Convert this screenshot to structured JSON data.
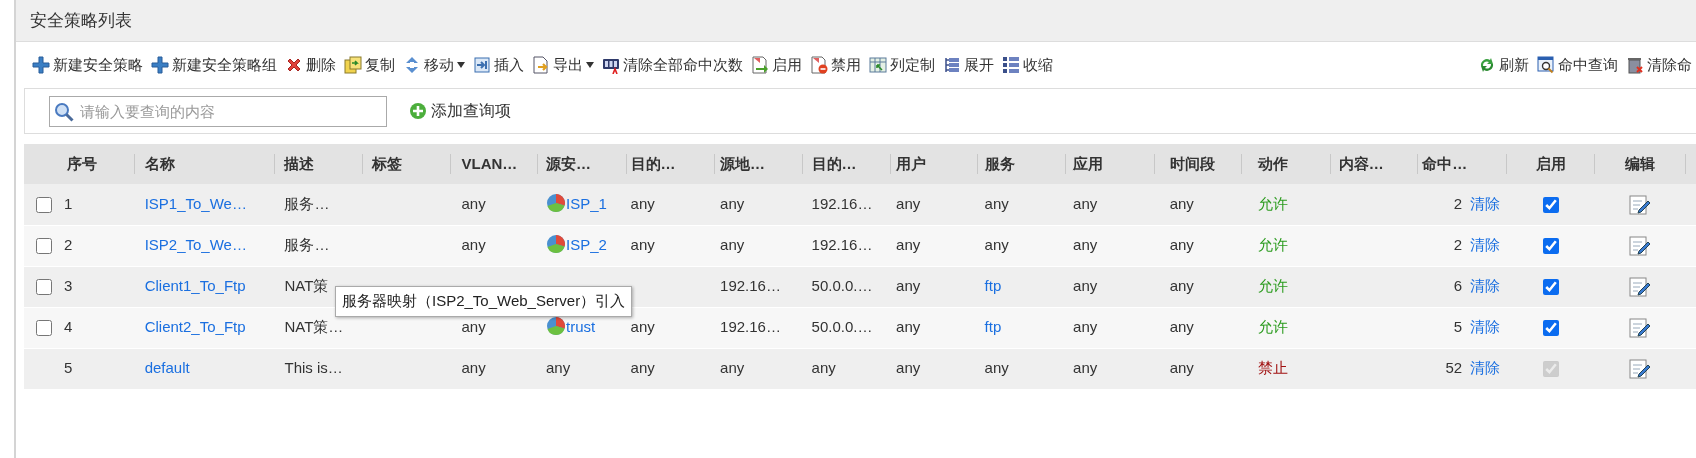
{
  "panel": {
    "title": "安全策略列表"
  },
  "toolbar": {
    "left": [
      {
        "kind": "plus",
        "label": "新建安全策略",
        "caret": false
      },
      {
        "kind": "plus",
        "label": "新建安全策略组",
        "caret": false
      },
      {
        "kind": "delete",
        "label": "删除",
        "caret": false
      },
      {
        "kind": "copy",
        "label": "复制",
        "caret": false
      },
      {
        "kind": "move",
        "label": "移动",
        "caret": true
      },
      {
        "kind": "insert",
        "label": "插入",
        "caret": false
      },
      {
        "kind": "export",
        "label": "导出",
        "caret": true
      },
      {
        "kind": "counter",
        "label": "清除全部命中次数",
        "caret": false
      },
      {
        "kind": "enable",
        "label": "启用",
        "caret": false
      },
      {
        "kind": "disable",
        "label": "禁用",
        "caret": false
      },
      {
        "kind": "columns",
        "label": "列定制",
        "caret": false
      },
      {
        "kind": "expand",
        "label": "展开",
        "caret": false
      },
      {
        "kind": "collapse",
        "label": "收缩",
        "caret": false
      }
    ],
    "right": [
      {
        "kind": "refresh",
        "label": "刷新",
        "caret": false
      },
      {
        "kind": "query",
        "label": "命中查询",
        "caret": false
      },
      {
        "kind": "trash",
        "label": "清除命",
        "caret": false
      }
    ]
  },
  "search": {
    "placeholder": "请输入要查询的内容",
    "add_button": "添加查询项"
  },
  "table": {
    "columns": [
      "序号",
      "名称",
      "描述",
      "标签",
      "VLAN…",
      "源安…",
      "目的…",
      "源地…",
      "目的…",
      "用户",
      "服务",
      "应用",
      "时间段",
      "动作",
      "内容…",
      "命中…",
      "启用",
      "编辑"
    ],
    "rows": [
      {
        "selectable": true,
        "selected": false,
        "cells": [
          {
            "kind": "seq",
            "text": "1"
          },
          {
            "kind": "link",
            "text": "ISP1_To_We…"
          },
          {
            "kind": "plain",
            "text": "服务…"
          },
          "",
          {
            "kind": "plain",
            "text": "any"
          },
          {
            "kind": "zone",
            "text": "ISP_1"
          },
          {
            "kind": "plain",
            "text": "any"
          },
          {
            "kind": "plain",
            "text": "any"
          },
          {
            "kind": "plain",
            "text": "192.16…"
          },
          {
            "kind": "plain",
            "text": "any"
          },
          {
            "kind": "plain",
            "text": "any"
          },
          {
            "kind": "plain",
            "text": "any"
          },
          {
            "kind": "plain",
            "text": "any"
          },
          {
            "kind": "allow",
            "text": "允许"
          },
          "",
          {
            "kind": "hits",
            "text": "2",
            "link": "清除"
          },
          {
            "kind": "check",
            "checked": true,
            "disabled": false
          },
          {
            "kind": "edit"
          }
        ]
      },
      {
        "selectable": true,
        "selected": false,
        "cells": [
          {
            "kind": "seq",
            "text": "2"
          },
          {
            "kind": "link",
            "text": "ISP2_To_We…"
          },
          {
            "kind": "plain",
            "text": "服务…"
          },
          "",
          {
            "kind": "plain",
            "text": "any"
          },
          {
            "kind": "zone",
            "text": "ISP_2"
          },
          {
            "kind": "plain",
            "text": "any"
          },
          {
            "kind": "plain",
            "text": "any"
          },
          {
            "kind": "plain",
            "text": "192.16…"
          },
          {
            "kind": "plain",
            "text": "any"
          },
          {
            "kind": "plain",
            "text": "any"
          },
          {
            "kind": "plain",
            "text": "any"
          },
          {
            "kind": "plain",
            "text": "any"
          },
          {
            "kind": "allow",
            "text": "允许"
          },
          "",
          {
            "kind": "hits",
            "text": "2",
            "link": "清除"
          },
          {
            "kind": "check",
            "checked": true,
            "disabled": false
          },
          {
            "kind": "edit"
          }
        ]
      },
      {
        "selectable": true,
        "selected": false,
        "cells": [
          {
            "kind": "seq",
            "text": "3"
          },
          {
            "kind": "link",
            "text": "Client1_To_Ftp"
          },
          {
            "kind": "plain",
            "text": "NAT策"
          },
          "",
          "",
          "",
          "",
          {
            "kind": "plain",
            "text": "192.16…"
          },
          {
            "kind": "plain",
            "text": "50.0.0.…"
          },
          {
            "kind": "plain",
            "text": "any"
          },
          {
            "kind": "link",
            "text": "ftp"
          },
          {
            "kind": "plain",
            "text": "any"
          },
          {
            "kind": "plain",
            "text": "any"
          },
          {
            "kind": "allow",
            "text": "允许"
          },
          "",
          {
            "kind": "hits",
            "text": "6",
            "link": "清除"
          },
          {
            "kind": "check",
            "checked": true,
            "disabled": false
          },
          {
            "kind": "edit"
          }
        ]
      },
      {
        "selectable": true,
        "selected": false,
        "cells": [
          {
            "kind": "seq",
            "text": "4"
          },
          {
            "kind": "link",
            "text": "Client2_To_Ftp"
          },
          {
            "kind": "plain",
            "text": "NAT策…"
          },
          "",
          {
            "kind": "plain",
            "text": "any"
          },
          {
            "kind": "zone",
            "text": "trust"
          },
          {
            "kind": "plain",
            "text": "any"
          },
          {
            "kind": "plain",
            "text": "192.16…"
          },
          {
            "kind": "plain",
            "text": "50.0.0.…"
          },
          {
            "kind": "plain",
            "text": "any"
          },
          {
            "kind": "link",
            "text": "ftp"
          },
          {
            "kind": "plain",
            "text": "any"
          },
          {
            "kind": "plain",
            "text": "any"
          },
          {
            "kind": "allow",
            "text": "允许"
          },
          "",
          {
            "kind": "hits",
            "text": "5",
            "link": "清除"
          },
          {
            "kind": "check",
            "checked": true,
            "disabled": false
          },
          {
            "kind": "edit"
          }
        ]
      },
      {
        "selectable": false,
        "cells": [
          {
            "kind": "seq",
            "text": "5"
          },
          {
            "kind": "link",
            "text": "default"
          },
          {
            "kind": "plain",
            "text": "This is…"
          },
          "",
          {
            "kind": "plain",
            "text": "any"
          },
          {
            "kind": "plain",
            "text": "any"
          },
          {
            "kind": "plain",
            "text": "any"
          },
          {
            "kind": "plain",
            "text": "any"
          },
          {
            "kind": "plain",
            "text": "any"
          },
          {
            "kind": "plain",
            "text": "any"
          },
          {
            "kind": "plain",
            "text": "any"
          },
          {
            "kind": "plain",
            "text": "any"
          },
          {
            "kind": "plain",
            "text": "any"
          },
          {
            "kind": "deny",
            "text": "禁止"
          },
          "",
          {
            "kind": "hits",
            "text": "52",
            "link": "清除"
          },
          {
            "kind": "check",
            "checked": true,
            "disabled": true
          },
          {
            "kind": "edit"
          }
        ]
      }
    ]
  },
  "tooltip": {
    "text": "服务器映射（ISP2_To_Web_Server）引入"
  }
}
